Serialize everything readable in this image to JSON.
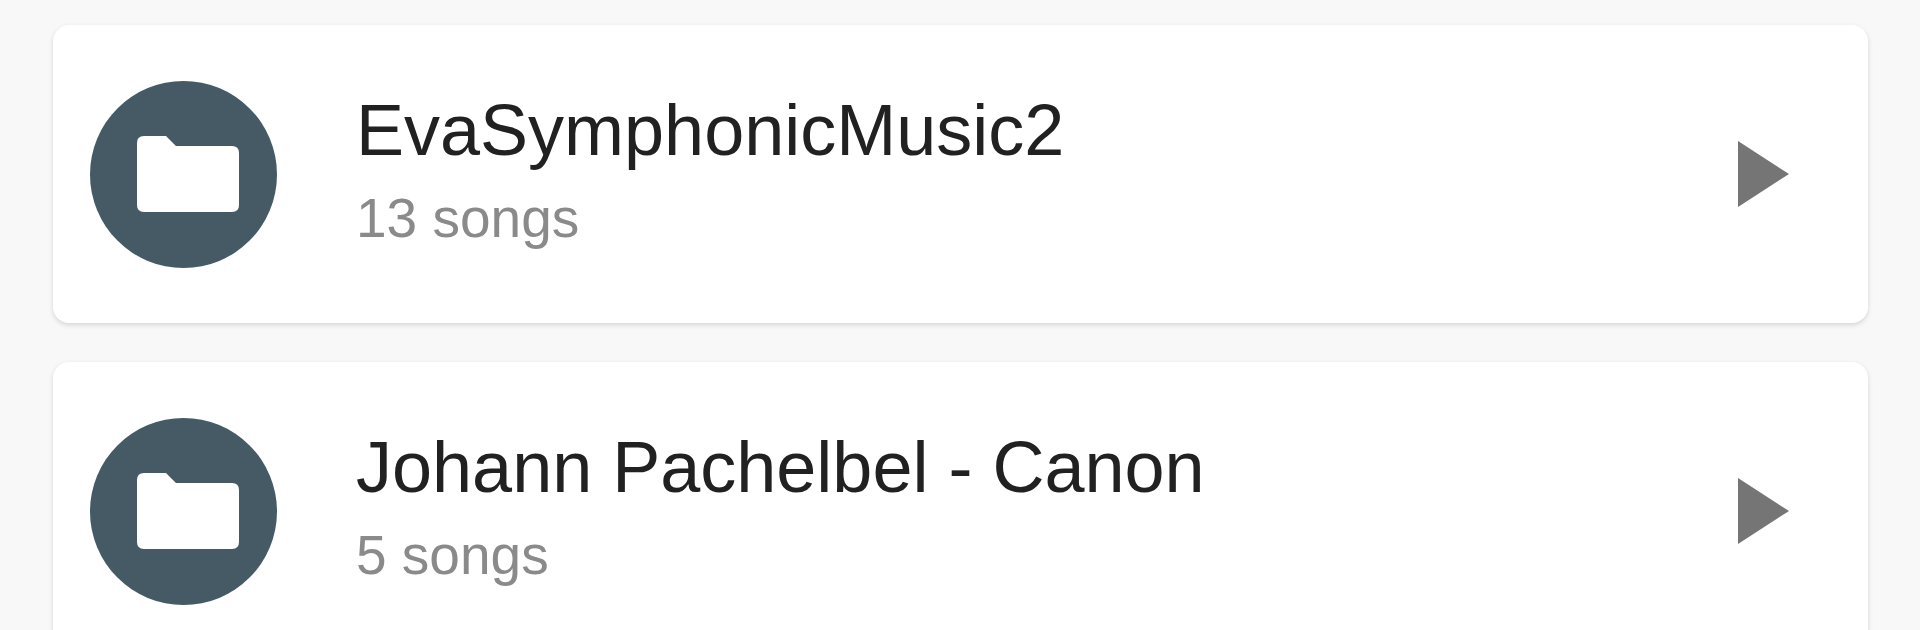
{
  "folders": [
    {
      "name": "EvaSymphonicMusic2",
      "count": "13 songs"
    },
    {
      "name": "Johann Pachelbel - Canon",
      "count": "5 songs"
    }
  ]
}
